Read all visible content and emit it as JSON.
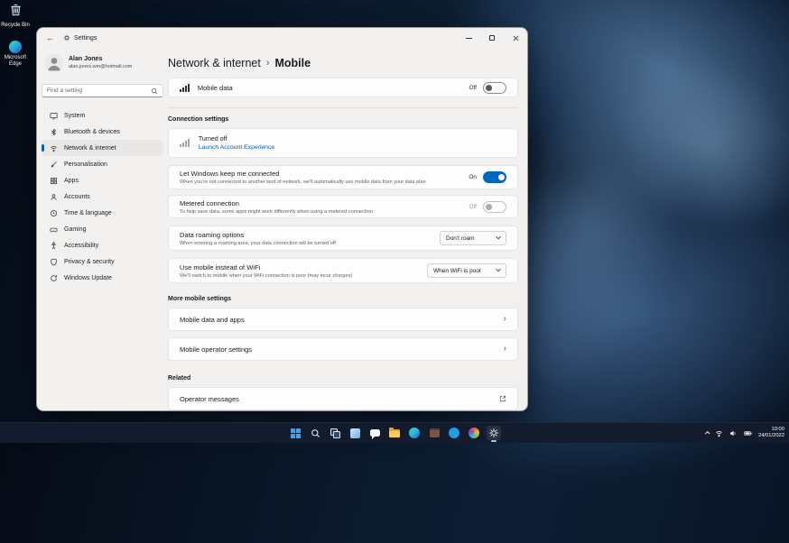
{
  "accent_color": "#0067c0",
  "link_color": "#0057b8",
  "desktop": {
    "icons": [
      {
        "name": "recycle-bin",
        "label": "Recycle Bin"
      },
      {
        "name": "microsoft-edge",
        "label": "Microsoft Edge"
      }
    ]
  },
  "settings_window": {
    "titlebar": {
      "title": "Settings"
    },
    "sidebar": {
      "profile": {
        "name": "Alan Jones",
        "email": "alan.jones.wm@hotmail.com"
      },
      "search_placeholder": "Find a setting",
      "items": [
        {
          "label": "System",
          "icon": "system-icon"
        },
        {
          "label": "Bluetooth & devices",
          "icon": "bluetooth-icon"
        },
        {
          "label": "Network & internet",
          "icon": "network-icon",
          "selected": true
        },
        {
          "label": "Personalisation",
          "icon": "personalisation-icon"
        },
        {
          "label": "Apps",
          "icon": "apps-icon"
        },
        {
          "label": "Accounts",
          "icon": "accounts-icon"
        },
        {
          "label": "Time & language",
          "icon": "time-language-icon"
        },
        {
          "label": "Gaming",
          "icon": "gaming-icon"
        },
        {
          "label": "Accessibility",
          "icon": "accessibility-icon"
        },
        {
          "label": "Privacy & security",
          "icon": "privacy-security-icon"
        },
        {
          "label": "Windows Update",
          "icon": "windows-update-icon"
        }
      ]
    },
    "main": {
      "breadcrumb": {
        "parent": "Network & internet",
        "separator": "›",
        "current": "Mobile"
      },
      "mobile_data": {
        "title": "Mobile data",
        "state": "Off"
      },
      "connection_settings": {
        "heading": "Connection settings",
        "status": {
          "text": "Turned off",
          "link": "Launch Account Experience"
        },
        "keep_connected": {
          "title": "Let Windows keep me connected",
          "description": "When you're not connected to another kind of network, we'll automatically use mobile data from your data plan",
          "state": "On"
        },
        "metered_connection": {
          "title": "Metered connection",
          "description": "To help save data, some apps might work differently when using a metered connection",
          "state": "Off"
        },
        "data_roaming": {
          "title": "Data roaming options",
          "description": "When entering a roaming area, your data connection will be turned off",
          "value": "Don't roam"
        },
        "mobile_instead_wifi": {
          "title": "Use mobile instead of WiFi",
          "description": "We'll switch to mobile when your WiFi connection is poor (may incur charges)",
          "value": "When WiFi is poor"
        }
      },
      "more_mobile_settings": {
        "heading": "More mobile settings",
        "items": [
          {
            "label": "Mobile data and apps"
          },
          {
            "label": "Mobile operator settings"
          }
        ]
      },
      "related": {
        "heading": "Related",
        "items": [
          {
            "label": "Operator messages"
          }
        ]
      }
    }
  },
  "taskbar": {
    "buttons": [
      "start",
      "search",
      "task-view",
      "widgets",
      "chat",
      "file-explorer",
      "edge",
      "store",
      "skype",
      "photos",
      "settings"
    ],
    "active_button": "settings",
    "tray": {
      "time": "10:00",
      "date": "24/01/2022"
    }
  }
}
